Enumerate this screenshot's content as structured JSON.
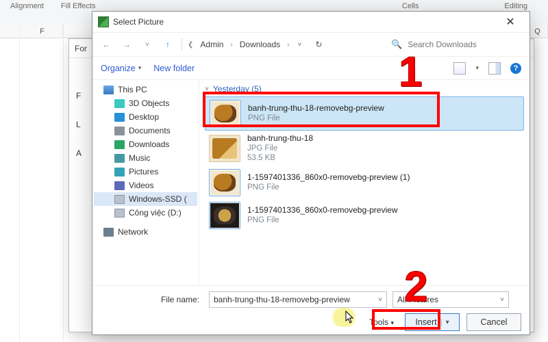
{
  "excel": {
    "ribbon_left": "Alignment",
    "ribbon_right1": "Cells",
    "ribbon_right2": "Editing",
    "col_F": "F",
    "col_Q": "Q",
    "bg_effects": "Fill Effects",
    "bg_dialog_title": "For",
    "bg_side": {
      "f": "F",
      "l": "L",
      "a": "A"
    }
  },
  "dialog": {
    "title": "Select Picture",
    "breadcrumb": {
      "seg1": "Admin",
      "seg2": "Downloads"
    },
    "search_placeholder": "Search Downloads",
    "organize": "Organize",
    "new_folder": "New folder",
    "tree": {
      "this_pc": "This PC",
      "objects3d": "3D Objects",
      "desktop": "Desktop",
      "documents": "Documents",
      "downloads": "Downloads",
      "music": "Music",
      "pictures": "Pictures",
      "videos": "Videos",
      "drive_c": "Windows-SSD (",
      "drive_d": "Công việc (D:)",
      "network": "Network"
    },
    "group_header": "Yesterday (5)",
    "files": [
      {
        "name": "banh-trung-thu-18-removebg-preview",
        "type": "PNG File"
      },
      {
        "name": "banh-trung-thu-18",
        "type": "JPG File",
        "size": "53.5 KB"
      },
      {
        "name": "1-1597401336_860x0-removebg-preview (1)",
        "type": "PNG File"
      },
      {
        "name": "1-1597401336_860x0-removebg-preview",
        "type": "PNG File"
      }
    ],
    "footer": {
      "filename_label": "File name:",
      "filename_value": "banh-trung-thu-18-removebg-preview",
      "type_filter": "All Pictures",
      "tools": "Tools",
      "insert": "Insert",
      "cancel": "Cancel"
    }
  },
  "markers": {
    "one": "1",
    "two": "2"
  }
}
